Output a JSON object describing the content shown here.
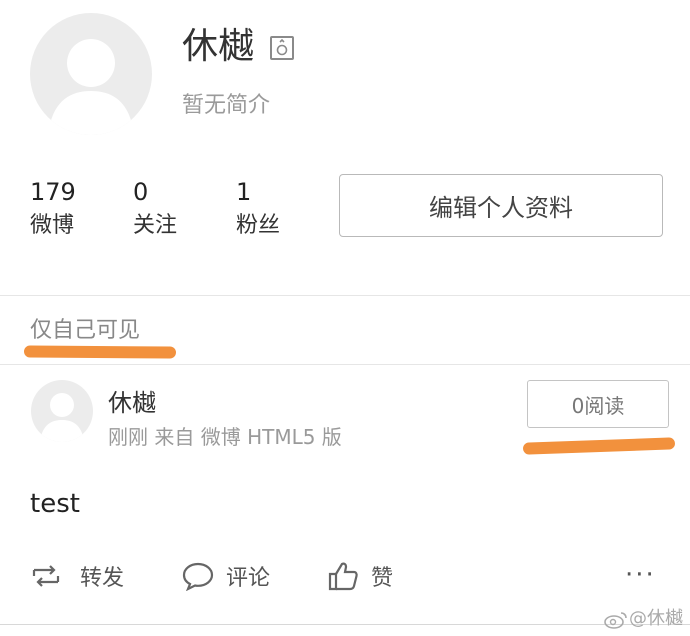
{
  "profile": {
    "name": "休樾",
    "bio": "暂无简介",
    "gender_icon": "gender-male-icon",
    "stats": [
      {
        "value": "179",
        "label": "微博"
      },
      {
        "value": "0",
        "label": "关注"
      },
      {
        "value": "1",
        "label": "粉丝"
      }
    ],
    "edit_button": "编辑个人资料"
  },
  "visibility": "仅自己可见",
  "post": {
    "author": "休樾",
    "meta": "刚刚 来自 微博 HTML5 版",
    "read_count": "0阅读",
    "text": "test",
    "actions": {
      "repost": "转发",
      "comment": "评论",
      "like": "赞",
      "more": "···"
    }
  },
  "watermark": "@休樾",
  "colors": {
    "highlight": "#f2913d",
    "avatar_bg": "#ececec"
  }
}
